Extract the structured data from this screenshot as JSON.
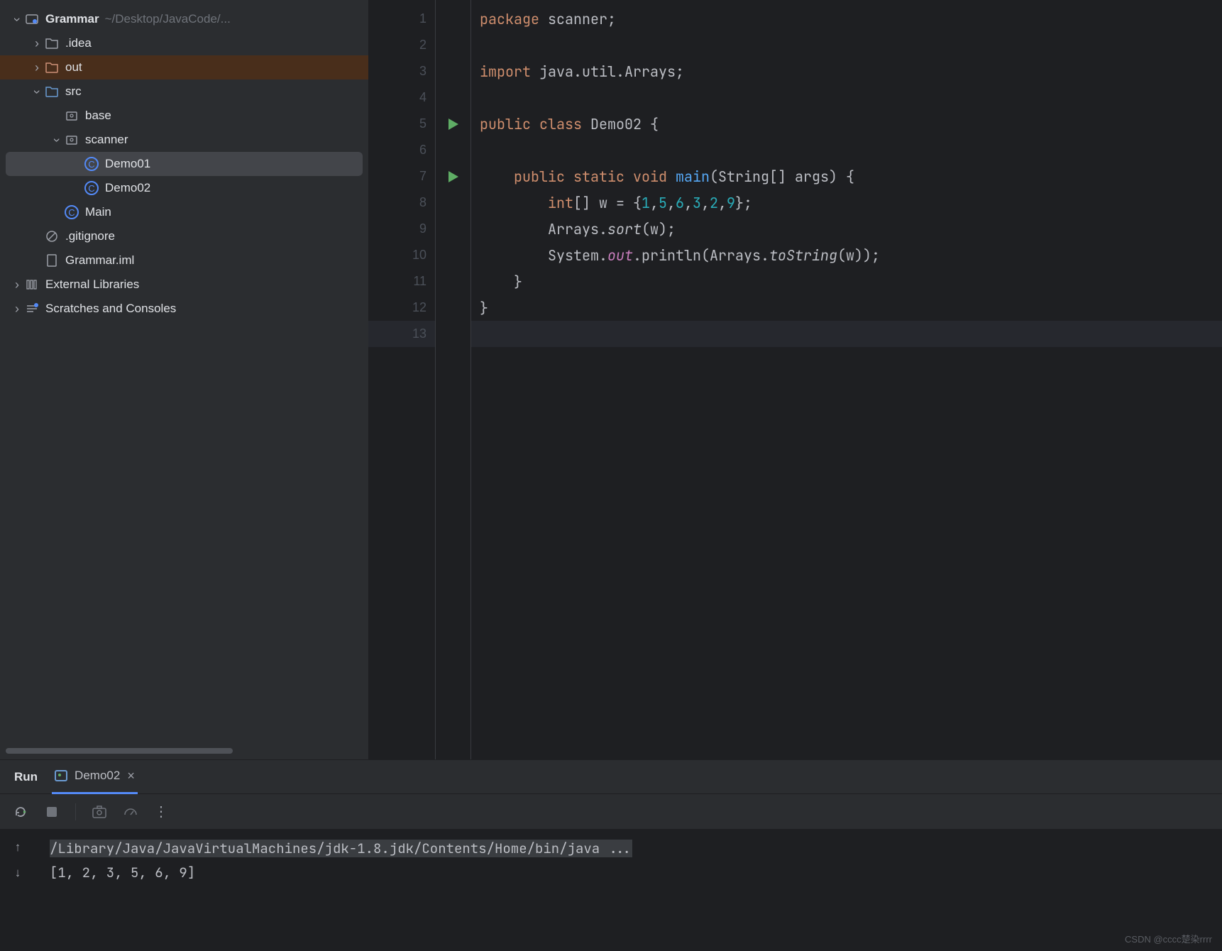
{
  "project_tree": {
    "root": {
      "name": "Grammar",
      "path": "~/Desktop/JavaCode/..."
    },
    "items": [
      {
        "label": ".idea",
        "indent": 1,
        "arrow": "collapsed",
        "icon": "folder"
      },
      {
        "label": "out",
        "indent": 1,
        "arrow": "collapsed",
        "icon": "folder-orange",
        "hl": true
      },
      {
        "label": "src",
        "indent": 1,
        "arrow": "expanded",
        "icon": "folder-blue"
      },
      {
        "label": "base",
        "indent": 2,
        "arrow": "none",
        "icon": "pkg"
      },
      {
        "label": "scanner",
        "indent": 2,
        "arrow": "expanded",
        "icon": "pkg"
      },
      {
        "label": "Demo01",
        "indent": 3,
        "arrow": "none",
        "icon": "java",
        "sel": true
      },
      {
        "label": "Demo02",
        "indent": 3,
        "arrow": "none",
        "icon": "java"
      },
      {
        "label": "Main",
        "indent": 2,
        "arrow": "none",
        "icon": "java"
      },
      {
        "label": ".gitignore",
        "indent": 1,
        "arrow": "none",
        "icon": "ignore"
      },
      {
        "label": "Grammar.iml",
        "indent": 1,
        "arrow": "none",
        "icon": "iml"
      },
      {
        "label": "External Libraries",
        "indent": 0,
        "arrow": "collapsed",
        "icon": "lib"
      },
      {
        "label": "Scratches and Consoles",
        "indent": 0,
        "arrow": "collapsed",
        "icon": "scratch"
      }
    ]
  },
  "editor": {
    "lines": [
      {
        "n": 1,
        "tokens": [
          [
            "kw",
            "package"
          ],
          [
            "str",
            " scanner;"
          ]
        ]
      },
      {
        "n": 2,
        "tokens": []
      },
      {
        "n": 3,
        "tokens": [
          [
            "kw",
            "import"
          ],
          [
            "str",
            " java.util.Arrays;"
          ]
        ]
      },
      {
        "n": 4,
        "tokens": []
      },
      {
        "n": 5,
        "run": true,
        "tokens": [
          [
            "kw",
            "public class"
          ],
          [
            "str",
            " Demo02 {"
          ]
        ]
      },
      {
        "n": 6,
        "tokens": []
      },
      {
        "n": 7,
        "run": true,
        "tokens": [
          [
            "str",
            "    "
          ],
          [
            "kw",
            "public static void"
          ],
          [
            "str",
            " "
          ],
          [
            "fn",
            "main"
          ],
          [
            "str",
            "(String[] args) {"
          ]
        ]
      },
      {
        "n": 8,
        "tokens": [
          [
            "str",
            "        "
          ],
          [
            "kw",
            "int"
          ],
          [
            "str",
            "[] w = {"
          ],
          [
            "num",
            "1"
          ],
          [
            "str",
            ","
          ],
          [
            "num",
            "5"
          ],
          [
            "str",
            ","
          ],
          [
            "num",
            "6"
          ],
          [
            "str",
            ","
          ],
          [
            "num",
            "3"
          ],
          [
            "str",
            ","
          ],
          [
            "num",
            "2"
          ],
          [
            "str",
            ","
          ],
          [
            "num",
            "9"
          ],
          [
            "str",
            "};"
          ]
        ]
      },
      {
        "n": 9,
        "tokens": [
          [
            "str",
            "        Arrays."
          ],
          [
            "method-it",
            "sort"
          ],
          [
            "str",
            "(w);"
          ]
        ]
      },
      {
        "n": 10,
        "tokens": [
          [
            "str",
            "        System."
          ],
          [
            "field",
            "out"
          ],
          [
            "str",
            ".println(Arrays."
          ],
          [
            "method-it",
            "toString"
          ],
          [
            "str",
            "(w));"
          ]
        ]
      },
      {
        "n": 11,
        "tokens": [
          [
            "str",
            "    }"
          ]
        ]
      },
      {
        "n": 12,
        "tokens": [
          [
            "str",
            "}"
          ]
        ]
      },
      {
        "n": 13,
        "current": true,
        "tokens": []
      }
    ]
  },
  "run_panel": {
    "title": "Run",
    "tab": "Demo02",
    "cmd": "/Library/Java/JavaVirtualMachines/jdk-1.8.jdk/Contents/Home/bin/java ...",
    "output": "[1, 2, 3, 5, 6, 9]"
  },
  "watermark": "CSDN @cccc楚染rrrr"
}
